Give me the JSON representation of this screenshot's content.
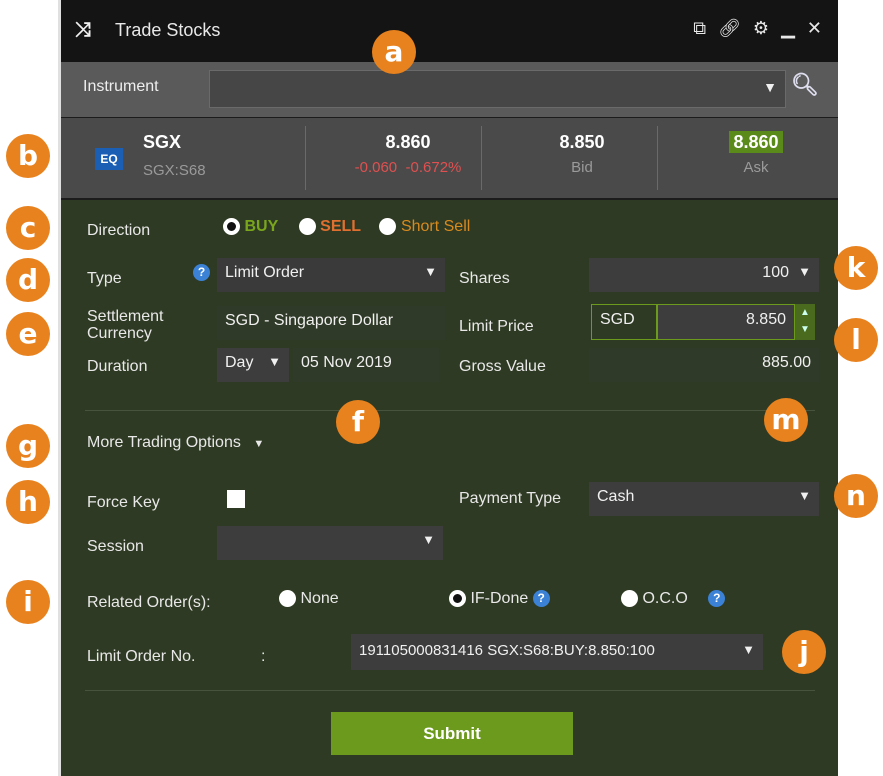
{
  "window": {
    "title": "Trade Stocks",
    "title_icon": "shuffle-icon"
  },
  "instrument": {
    "label": "Instrument",
    "value": ""
  },
  "quote": {
    "badge": "EQ",
    "symbol": "SGX",
    "code": "SGX:S68",
    "last": "8.860",
    "change": "-0.060",
    "change_pct": "-0.672%",
    "bid": "8.850",
    "bid_label": "Bid",
    "ask": "8.860",
    "ask_label": "Ask"
  },
  "form": {
    "direction_label": "Direction",
    "direction_options": [
      "BUY",
      "SELL",
      "Short Sell"
    ],
    "direction_selected": "BUY",
    "type_label": "Type",
    "type_value": "Limit Order",
    "settlement_label_1": "Settlement",
    "settlement_label_2": "Currency",
    "settlement_value": "SGD - Singapore Dollar",
    "duration_label": "Duration",
    "duration_value": "Day",
    "duration_date": "05 Nov 2019",
    "shares_label": "Shares",
    "shares_value": "100",
    "limit_price_label": "Limit Price",
    "limit_price_currency": "SGD",
    "limit_price_value": "8.850",
    "gross_value_label": "Gross Value",
    "gross_value": "885.00",
    "more_options_label": "More Trading Options",
    "force_key_label": "Force Key",
    "payment_type_label": "Payment Type",
    "payment_type_value": "Cash",
    "session_label": "Session",
    "session_value": "",
    "related_orders_label": "Related Order(s):",
    "related_options": [
      "None",
      "IF-Done",
      "O.C.O"
    ],
    "related_selected": "IF-Done",
    "limit_order_no_label": "Limit Order No.",
    "limit_order_no_colon": ":",
    "limit_order_no_value": "191105000831416 SGX:S68:BUY:8.850:100",
    "submit_label": "Submit"
  },
  "callouts": [
    "a",
    "b",
    "c",
    "d",
    "e",
    "f",
    "g",
    "h",
    "i",
    "j",
    "k",
    "l",
    "m",
    "n"
  ],
  "colors": {
    "buy": "#7aa61e",
    "sell": "#e07030",
    "short_sell": "#d88a1e",
    "callout": "#e8821e",
    "submit": "#6b9a1c",
    "change_negative": "#e05050"
  }
}
